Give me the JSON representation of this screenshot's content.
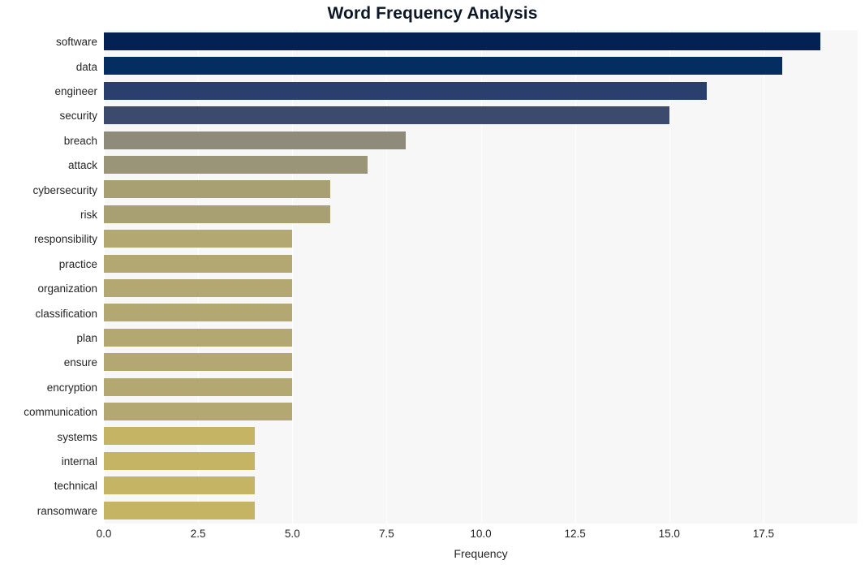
{
  "chart_data": {
    "type": "bar",
    "orientation": "horizontal",
    "title": "Word Frequency Analysis",
    "xlabel": "Frequency",
    "ylabel": "",
    "categories": [
      "software",
      "data",
      "engineer",
      "security",
      "breach",
      "attack",
      "cybersecurity",
      "risk",
      "responsibility",
      "practice",
      "organization",
      "classification",
      "plan",
      "ensure",
      "encryption",
      "communication",
      "systems",
      "internal",
      "technical",
      "ransomware"
    ],
    "values": [
      19,
      18,
      16,
      15,
      8,
      7,
      6,
      6,
      5,
      5,
      5,
      5,
      5,
      5,
      5,
      5,
      4,
      4,
      4,
      4
    ],
    "bar_colors": [
      "#032152",
      "#042d60",
      "#2a3f6e",
      "#3c4a6e",
      "#8e8b7a",
      "#9a9479",
      "#a89f72",
      "#a89f72",
      "#b3a871",
      "#b3a871",
      "#b3a871",
      "#b3a871",
      "#b3a871",
      "#b3a871",
      "#b3a871",
      "#b3a871",
      "#c4b464",
      "#c4b464",
      "#c4b464",
      "#c4b464"
    ],
    "xticks": [
      "0.0",
      "2.5",
      "5.0",
      "7.5",
      "10.0",
      "12.5",
      "15.0",
      "17.5"
    ],
    "xtick_values": [
      0,
      2.5,
      5,
      7.5,
      10,
      12.5,
      15,
      17.5
    ],
    "xlim": [
      0,
      20
    ],
    "grid": true,
    "grid_axis": "x",
    "legend": "none",
    "plot_background": "#f7f7f8",
    "figure_background": "#ffffff",
    "title_color": "#0d1726",
    "tick_color": "#252525"
  }
}
